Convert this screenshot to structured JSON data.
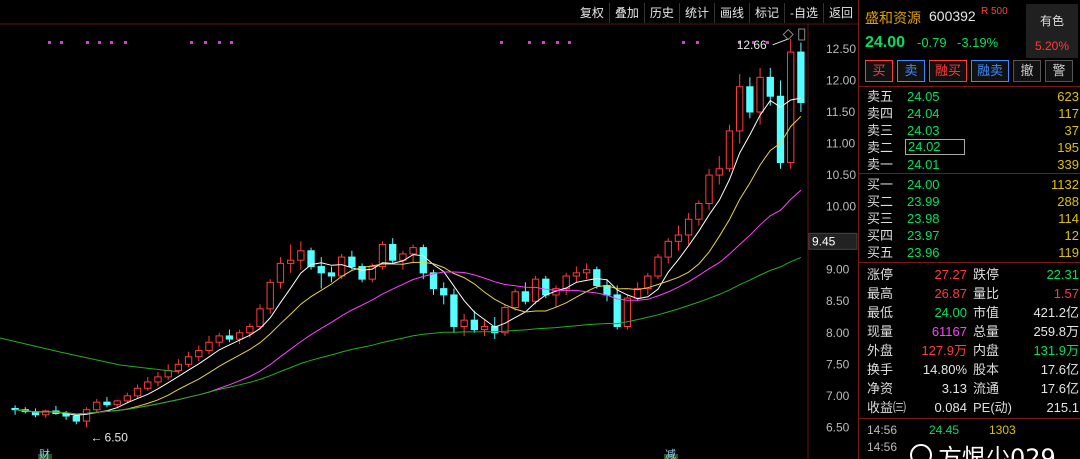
{
  "toolbar": [
    "复权",
    "叠加",
    "历史",
    "统计",
    "画线",
    "标记",
    "-自选",
    "返回"
  ],
  "chart": {
    "price_labels": [
      "12.50",
      "12.00",
      "11.50",
      "11.00",
      "10.50",
      "10.00",
      "9.50",
      "9.00",
      "8.50",
      "8.00",
      "7.50",
      "7.00",
      "6.50"
    ],
    "current_price_tag": "9.45",
    "high_label": "12.66",
    "low_label": "6.50",
    "bottom_marks": [
      "财",
      "减"
    ]
  },
  "chart_data": {
    "type": "candlestick",
    "y_range": [
      6.3,
      12.8
    ],
    "candles": [
      [
        6.8,
        6.85,
        6.7,
        6.78
      ],
      [
        6.78,
        6.82,
        6.72,
        6.75
      ],
      [
        6.75,
        6.8,
        6.66,
        6.7
      ],
      [
        6.7,
        6.78,
        6.65,
        6.76
      ],
      [
        6.76,
        6.84,
        6.7,
        6.72
      ],
      [
        6.72,
        6.76,
        6.62,
        6.68
      ],
      [
        6.68,
        6.72,
        6.55,
        6.6
      ],
      [
        6.6,
        6.82,
        6.5,
        6.78
      ],
      [
        6.78,
        6.95,
        6.75,
        6.9
      ],
      [
        6.9,
        6.98,
        6.82,
        6.86
      ],
      [
        6.86,
        6.94,
        6.8,
        6.92
      ],
      [
        6.92,
        7.05,
        6.88,
        7.0
      ],
      [
        7.0,
        7.18,
        6.96,
        7.12
      ],
      [
        7.12,
        7.3,
        7.08,
        7.22
      ],
      [
        7.22,
        7.38,
        7.15,
        7.3
      ],
      [
        7.3,
        7.5,
        7.25,
        7.4
      ],
      [
        7.4,
        7.58,
        7.35,
        7.5
      ],
      [
        7.5,
        7.7,
        7.45,
        7.62
      ],
      [
        7.62,
        7.8,
        7.55,
        7.72
      ],
      [
        7.72,
        7.95,
        7.66,
        7.85
      ],
      [
        7.85,
        8.0,
        7.78,
        7.95
      ],
      [
        7.95,
        8.05,
        7.85,
        7.9
      ],
      [
        7.9,
        8.05,
        7.82,
        8.0
      ],
      [
        8.0,
        8.15,
        7.92,
        8.1
      ],
      [
        8.1,
        8.45,
        8.05,
        8.38
      ],
      [
        8.38,
        8.85,
        8.3,
        8.8
      ],
      [
        8.8,
        9.2,
        8.7,
        9.1
      ],
      [
        9.1,
        9.4,
        8.95,
        9.15
      ],
      [
        9.15,
        9.45,
        9.0,
        9.3
      ],
      [
        9.3,
        9.35,
        9.0,
        9.05
      ],
      [
        9.05,
        9.2,
        8.7,
        8.95
      ],
      [
        8.95,
        9.05,
        8.8,
        8.9
      ],
      [
        8.9,
        9.25,
        8.85,
        9.2
      ],
      [
        9.2,
        9.3,
        9.0,
        9.05
      ],
      [
        9.05,
        9.1,
        8.8,
        8.85
      ],
      [
        8.85,
        9.1,
        8.8,
        9.05
      ],
      [
        9.05,
        9.45,
        9.0,
        9.4
      ],
      [
        9.4,
        9.5,
        9.1,
        9.15
      ],
      [
        9.15,
        9.3,
        9.0,
        9.25
      ],
      [
        9.25,
        9.4,
        9.1,
        9.35
      ],
      [
        9.35,
        9.4,
        8.85,
        8.95
      ],
      [
        8.95,
        9.0,
        8.6,
        8.7
      ],
      [
        8.7,
        8.8,
        8.45,
        8.6
      ],
      [
        8.6,
        8.7,
        8.0,
        8.1
      ],
      [
        8.1,
        8.3,
        7.95,
        8.2
      ],
      [
        8.2,
        8.35,
        8.0,
        8.05
      ],
      [
        8.05,
        8.2,
        7.95,
        8.1
      ],
      [
        8.1,
        8.25,
        7.9,
        8.0
      ],
      [
        8.0,
        8.45,
        7.95,
        8.4
      ],
      [
        8.4,
        8.7,
        8.35,
        8.65
      ],
      [
        8.65,
        8.8,
        8.45,
        8.5
      ],
      [
        8.5,
        8.9,
        8.45,
        8.85
      ],
      [
        8.85,
        8.9,
        8.55,
        8.6
      ],
      [
        8.6,
        8.75,
        8.4,
        8.7
      ],
      [
        8.7,
        8.95,
        8.6,
        8.9
      ],
      [
        8.9,
        9.05,
        8.8,
        8.95
      ],
      [
        8.95,
        9.1,
        8.85,
        9.0
      ],
      [
        9.0,
        9.05,
        8.7,
        8.75
      ],
      [
        8.75,
        8.85,
        8.5,
        8.6
      ],
      [
        8.6,
        8.75,
        8.05,
        8.1
      ],
      [
        8.1,
        8.6,
        8.05,
        8.55
      ],
      [
        8.55,
        8.8,
        8.5,
        8.7
      ],
      [
        8.7,
        8.95,
        8.6,
        8.9
      ],
      [
        8.9,
        9.25,
        8.85,
        9.2
      ],
      [
        9.2,
        9.5,
        9.1,
        9.45
      ],
      [
        9.45,
        9.7,
        9.3,
        9.55
      ],
      [
        9.55,
        9.9,
        9.4,
        9.8
      ],
      [
        9.8,
        10.1,
        9.7,
        10.05
      ],
      [
        10.05,
        10.6,
        9.95,
        10.5
      ],
      [
        10.5,
        10.8,
        10.35,
        10.6
      ],
      [
        10.6,
        11.3,
        10.55,
        11.2
      ],
      [
        11.2,
        12.1,
        11.0,
        11.9
      ],
      [
        11.9,
        12.05,
        11.4,
        11.5
      ],
      [
        11.5,
        12.2,
        11.3,
        12.05
      ],
      [
        12.05,
        12.2,
        11.6,
        11.75
      ],
      [
        11.75,
        12.0,
        10.6,
        10.7
      ],
      [
        10.7,
        12.66,
        10.6,
        12.45
      ],
      [
        12.45,
        12.6,
        11.5,
        11.65
      ]
    ]
  },
  "panel": {
    "name": "盛和资源",
    "code": "600392",
    "r_badge": "R 500",
    "tag": "有色",
    "tag_pct": "5.20%",
    "price": "24.00",
    "change": "-0.79",
    "change_pct": "-3.19%",
    "buttons": [
      "买",
      "卖",
      "融买",
      "融卖",
      "撤",
      "警"
    ],
    "asks": [
      {
        "label": "卖五",
        "price": "24.05",
        "vol": "623"
      },
      {
        "label": "卖四",
        "price": "24.04",
        "vol": "117"
      },
      {
        "label": "卖三",
        "price": "24.03",
        "vol": "37"
      },
      {
        "label": "卖二",
        "price": "24.02",
        "vol": "195"
      },
      {
        "label": "卖一",
        "price": "24.01",
        "vol": "339"
      }
    ],
    "bids": [
      {
        "label": "买一",
        "price": "24.00",
        "vol": "1132"
      },
      {
        "label": "买二",
        "price": "23.99",
        "vol": "288"
      },
      {
        "label": "买三",
        "price": "23.98",
        "vol": "114"
      },
      {
        "label": "买四",
        "price": "23.97",
        "vol": "12"
      },
      {
        "label": "买五",
        "price": "23.96",
        "vol": "119"
      }
    ],
    "stats": [
      {
        "k1": "涨停",
        "v1": "27.27",
        "c1": "red",
        "k2": "跌停",
        "v2": "22.31",
        "c2": "green"
      },
      {
        "k1": "最高",
        "v1": "26.87",
        "c1": "red",
        "k2": "量比",
        "v2": "1.57",
        "c2": "red"
      },
      {
        "k1": "最低",
        "v1": "24.00",
        "c1": "green",
        "k2": "市值",
        "v2": "421.2亿",
        "c2": "white"
      },
      {
        "k1": "现量",
        "v1": "61167",
        "c1": "mag",
        "k2": "总量",
        "v2": "259.8万",
        "c2": "white"
      },
      {
        "k1": "外盘",
        "v1": "127.9万",
        "c1": "red",
        "k2": "内盘",
        "v2": "131.9万",
        "c2": "green"
      },
      {
        "k1": "换手",
        "v1": "14.80%",
        "c1": "white",
        "k2": "股本",
        "v2": "17.6亿",
        "c2": "white"
      },
      {
        "k1": "净资",
        "v1": "3.13",
        "c1": "white",
        "k2": "流通",
        "v2": "17.6亿",
        "c2": "white"
      },
      {
        "k1": "收益㈢",
        "v1": "0.084",
        "c1": "white",
        "k2": "PE(动)",
        "v2": "215.1",
        "c2": "white"
      }
    ],
    "ticks": [
      {
        "t": "14:56",
        "p": "24.45",
        "v": "1303"
      },
      {
        "t": "14:56",
        "p": "",
        "v": ""
      }
    ]
  },
  "watermark": "方恨少029"
}
